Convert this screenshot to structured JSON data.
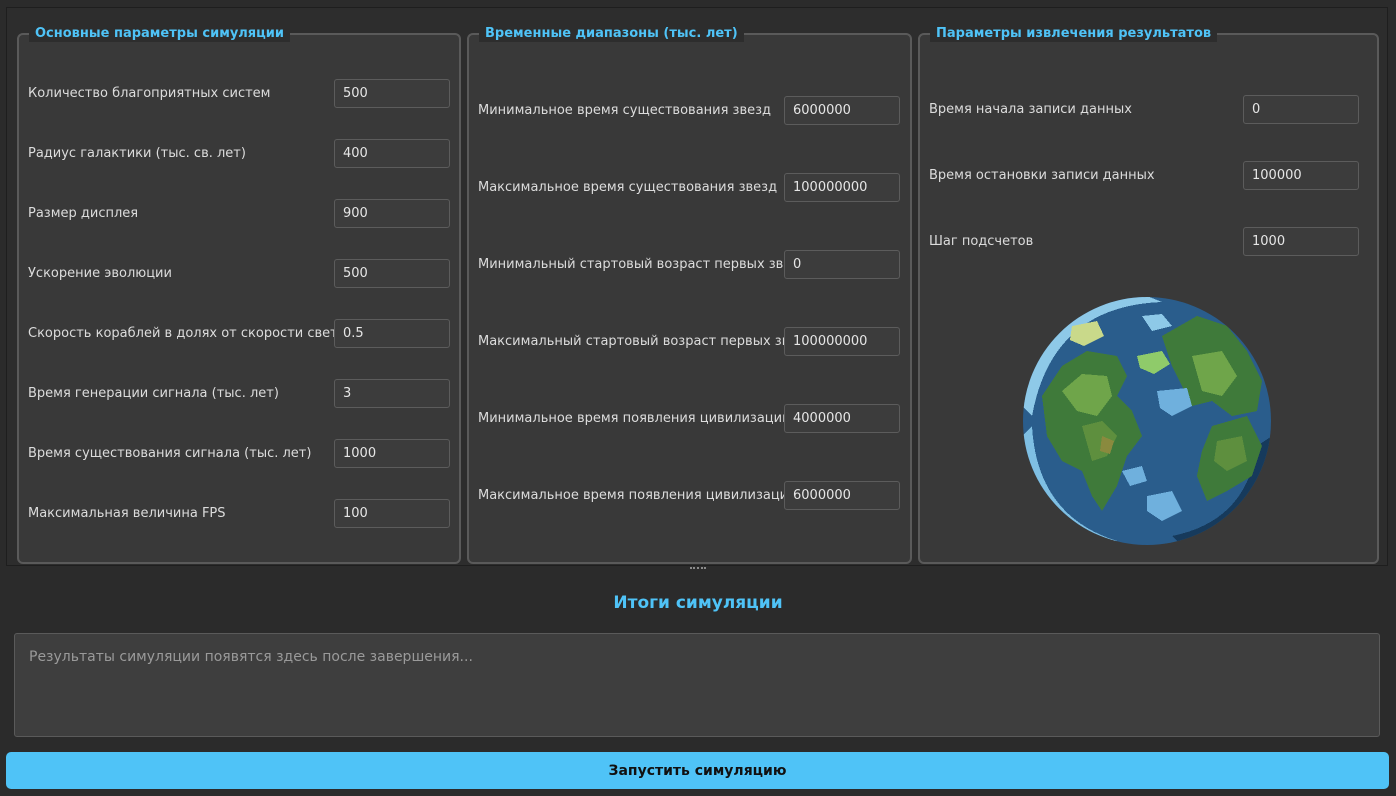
{
  "main_params": {
    "title": "Основные параметры симуляции",
    "fields": [
      {
        "label": "Количество благоприятных систем",
        "value": "500"
      },
      {
        "label": "Радиус галактики (тыс. св. лет)",
        "value": "400"
      },
      {
        "label": "Размер дисплея",
        "value": "900"
      },
      {
        "label": "Ускорение эволюции",
        "value": "500"
      },
      {
        "label": "Скорость кораблей в долях от скорости света",
        "value": "0.5"
      },
      {
        "label": "Время генерации сигнала (тыс. лет)",
        "value": "3"
      },
      {
        "label": "Время существования сигнала (тыс. лет)",
        "value": "1000"
      },
      {
        "label": "Максимальная величина FPS",
        "value": "100"
      }
    ]
  },
  "time_ranges": {
    "title": "Временные диапазоны (тыс. лет)",
    "fields": [
      {
        "label": "Минимальное время существования звезд",
        "value": "6000000"
      },
      {
        "label": "Максимальное время существования звезд",
        "value": "100000000"
      },
      {
        "label": "Минимальный стартовый возраст первых звезд",
        "value": "0"
      },
      {
        "label": "Максимальный стартовый возраст первых звезд",
        "value": "100000000"
      },
      {
        "label": "Минимальное время появления цивилизации",
        "value": "4000000"
      },
      {
        "label": "Максимальное время появления цивилизации",
        "value": "6000000"
      }
    ]
  },
  "extraction_params": {
    "title": "Параметры извлечения результатов",
    "fields": [
      {
        "label": "Время начала записи данных",
        "value": "0"
      },
      {
        "label": "Время остановки записи данных",
        "value": "100000"
      },
      {
        "label": "Шаг подсчетов",
        "value": "1000"
      }
    ],
    "image_icon": "planet-earth-icon"
  },
  "results": {
    "title": "Итоги симуляции",
    "placeholder": "Результаты симуляции появятся здесь после завершения..."
  },
  "run_button_label": "Запустить симуляцию",
  "colors": {
    "accent": "#4fc3f7",
    "background": "#2b2b2b",
    "panel": "#393939"
  }
}
